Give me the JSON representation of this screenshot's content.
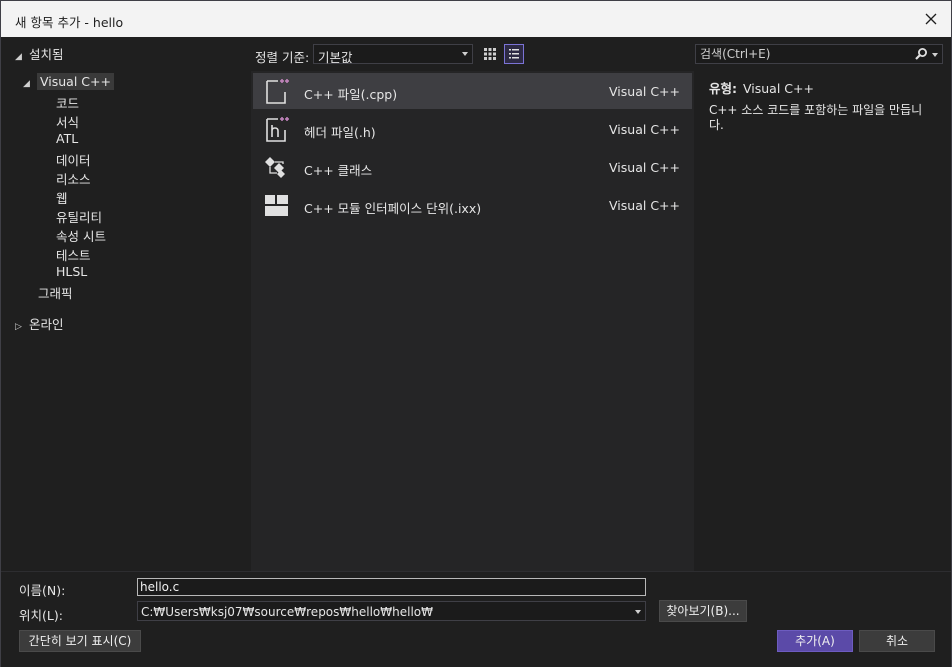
{
  "window": {
    "title": "새 항목 추가 - hello"
  },
  "tree": {
    "installed": "설치됨",
    "visual_cpp": "Visual C++",
    "children": [
      "코드",
      "서식",
      "ATL",
      "데이터",
      "리소스",
      "웹",
      "유틸리티",
      "속성 시트",
      "테스트",
      "HLSL"
    ],
    "graphics": "그래픽",
    "online": "온라인"
  },
  "toolbar": {
    "sort_label": "정렬 기준:",
    "sort_value": "기본값"
  },
  "search": {
    "placeholder": "검색(Ctrl+E)"
  },
  "items": [
    {
      "name": "C++ 파일(.cpp)",
      "type": "Visual C++",
      "icon": "cpp-file-icon"
    },
    {
      "name": "헤더 파일(.h)",
      "type": "Visual C++",
      "icon": "header-file-icon"
    },
    {
      "name": "C++ 클래스",
      "type": "Visual C++",
      "icon": "cpp-class-icon"
    },
    {
      "name": "C++ 모듈 인터페이스 단위(.ixx)",
      "type": "Visual C++",
      "icon": "module-interface-icon"
    }
  ],
  "details": {
    "type_label": "유형:",
    "type_value": "Visual C++",
    "description": "C++ 소스 코드를 포함하는 파일을 만듭니다."
  },
  "form": {
    "name_label": "이름(N):",
    "name_value": "hello.c",
    "location_label": "위치(L):",
    "location_value": "C:₩Users₩ksj07₩source₩repos₩hello₩hello₩",
    "browse_button": "찾아보기(B)...",
    "compact_button": "간단히 보기 표시(C)",
    "add_button": "추가(A)",
    "cancel_button": "취소"
  },
  "colors": {
    "accent": "#5b4aa8",
    "background": "#1f1f1f",
    "list_background": "#252526",
    "selection": "#3e3e42"
  }
}
